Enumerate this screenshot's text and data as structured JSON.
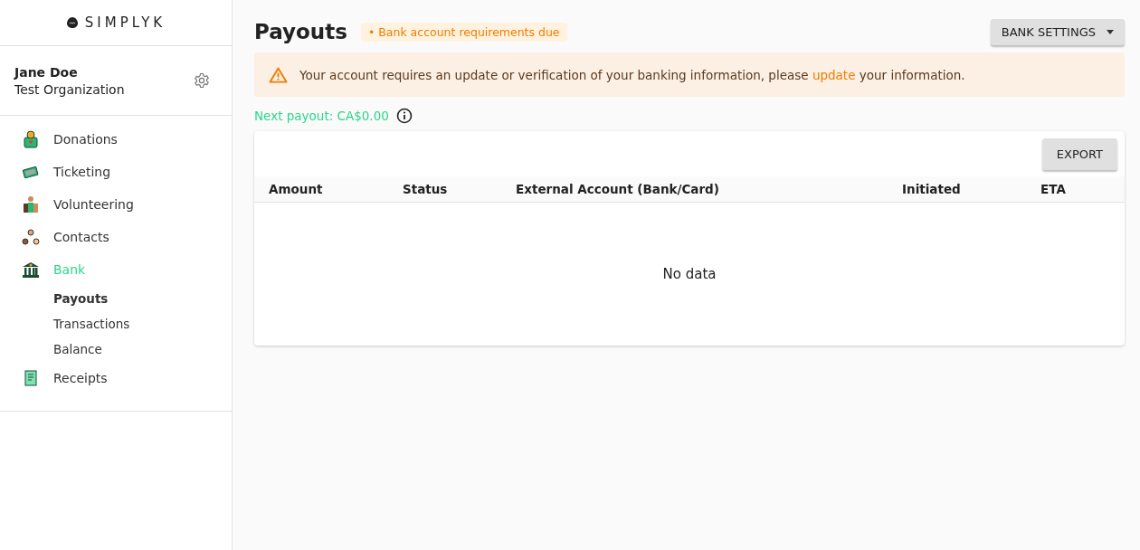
{
  "brand": {
    "name": "SIMPLYK"
  },
  "user": {
    "name": "Jane Doe",
    "organization": "Test Organization"
  },
  "nav": [
    {
      "label": "Donations",
      "selected": false
    },
    {
      "label": "Ticketing",
      "selected": false
    },
    {
      "label": "Volunteering",
      "selected": false
    },
    {
      "label": "Contacts",
      "selected": false
    },
    {
      "label": "Bank",
      "selected": true,
      "children": [
        {
          "label": "Payouts",
          "selected": true
        },
        {
          "label": "Transactions",
          "selected": false
        },
        {
          "label": "Balance",
          "selected": false
        }
      ]
    },
    {
      "label": "Receipts",
      "selected": false
    }
  ],
  "page": {
    "title": "Payouts",
    "badge": "• Bank account requirements due",
    "settings_button": "BANK SETTINGS"
  },
  "alert": {
    "text_before": "Your account requires an update or verification of your banking information, please",
    "link": "update",
    "text_after": "your information."
  },
  "next_payout": "Next payout: CA$0.00",
  "table": {
    "export_button": "EXPORT",
    "columns": [
      "Amount",
      "Status",
      "External Account (Bank/Card)",
      "Initiated",
      "ETA"
    ],
    "empty_text": "No data"
  }
}
